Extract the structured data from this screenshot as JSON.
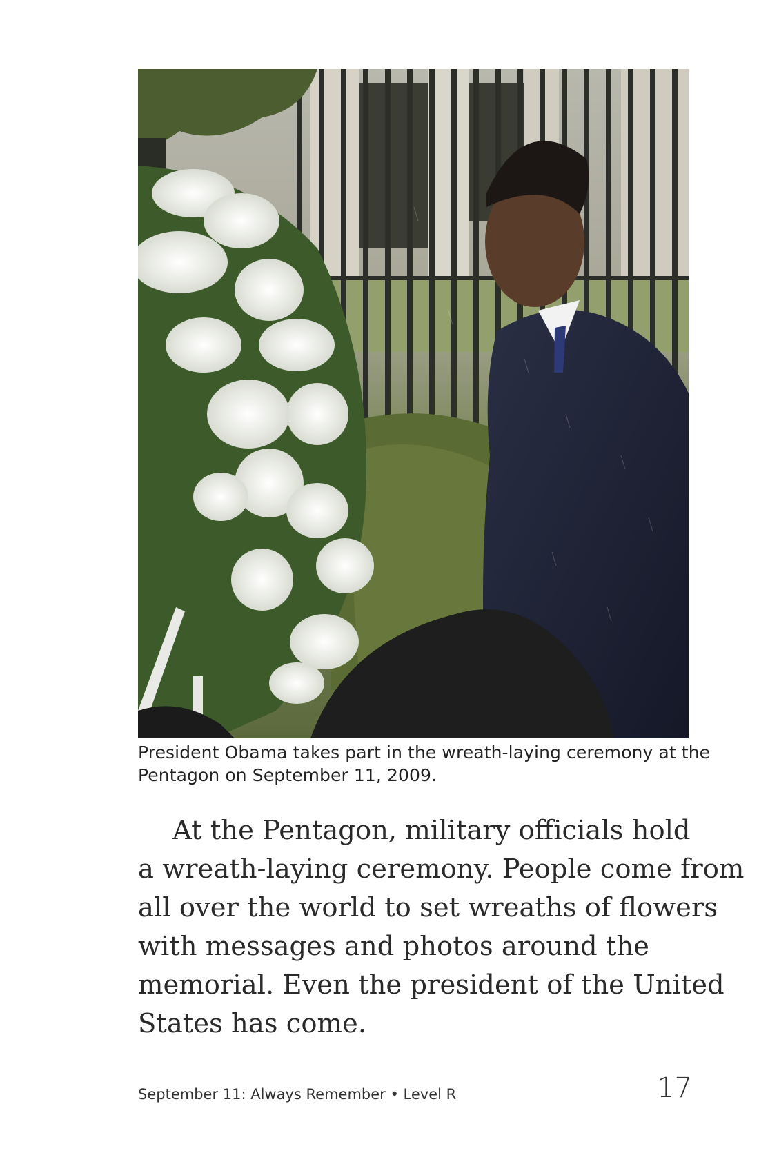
{
  "photo": {
    "icon": "photo-wreath-ceremony"
  },
  "caption": {
    "line1": "President Obama takes part in the wreath-laying ceremony at the",
    "line2": "Pentagon on September 11, 2009."
  },
  "body": {
    "lines": [
      "At the Pentagon, military officials hold",
      "a wreath-laying ceremony. People come from",
      "all over the world to set wreaths of flowers",
      "with messages and photos around  the",
      "memorial. Even the president of the United",
      "States has come."
    ]
  },
  "footer": {
    "title": "September 11: Always Remember • Level R",
    "page_number": "17"
  }
}
